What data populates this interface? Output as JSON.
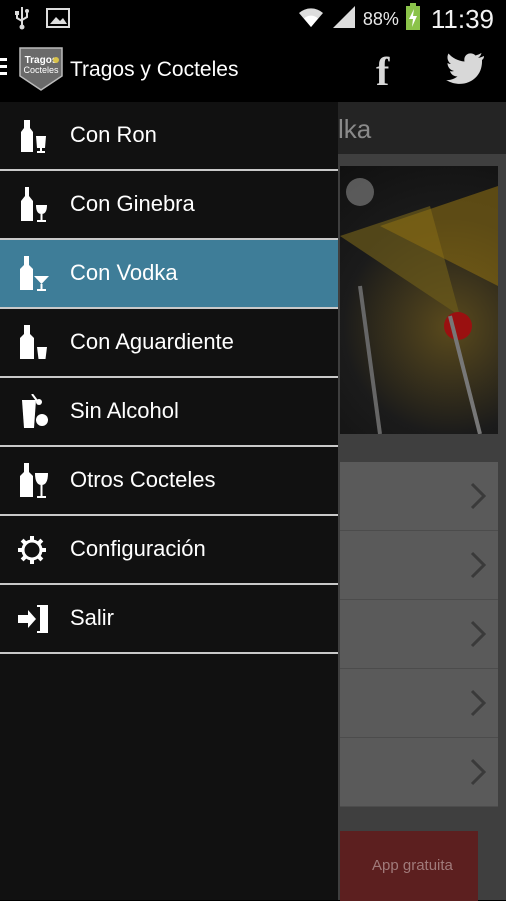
{
  "status_bar": {
    "battery_percent": "88%",
    "time": "11:39",
    "icons": [
      "usb-icon",
      "image-icon",
      "wifi-icon",
      "signal-icon",
      "battery-charging-icon"
    ]
  },
  "drawer": {
    "app_title": "Tragos y Cocteles",
    "logo_text": [
      "Tragos",
      "Cocteles"
    ],
    "items": [
      {
        "label": "Con Ron",
        "icon": "bottle-glass-icon",
        "active": false
      },
      {
        "label": "Con Ginebra",
        "icon": "bottle-wineglass-icon",
        "active": false
      },
      {
        "label": "Con Vodka",
        "icon": "bottle-martini-icon",
        "active": true
      },
      {
        "label": "Con Aguardiente",
        "icon": "bottle-shot-icon",
        "active": false
      },
      {
        "label": "Sin Alcohol",
        "icon": "juice-glass-icon",
        "active": false
      },
      {
        "label": "Otros Cocteles",
        "icon": "bottle-cocktail-icon",
        "active": false
      },
      {
        "label": "Configuración",
        "icon": "gear-icon",
        "active": false
      },
      {
        "label": "Salir",
        "icon": "exit-door-icon",
        "active": false
      }
    ]
  },
  "background": {
    "title_fragment": "lka",
    "ad_label": "App gratuita",
    "share_icons": [
      "facebook-icon",
      "twitter-icon"
    ]
  },
  "colors": {
    "active_item": "#3e7d98",
    "drawer_bg": "#111111",
    "divider": "#c9c9c9"
  }
}
